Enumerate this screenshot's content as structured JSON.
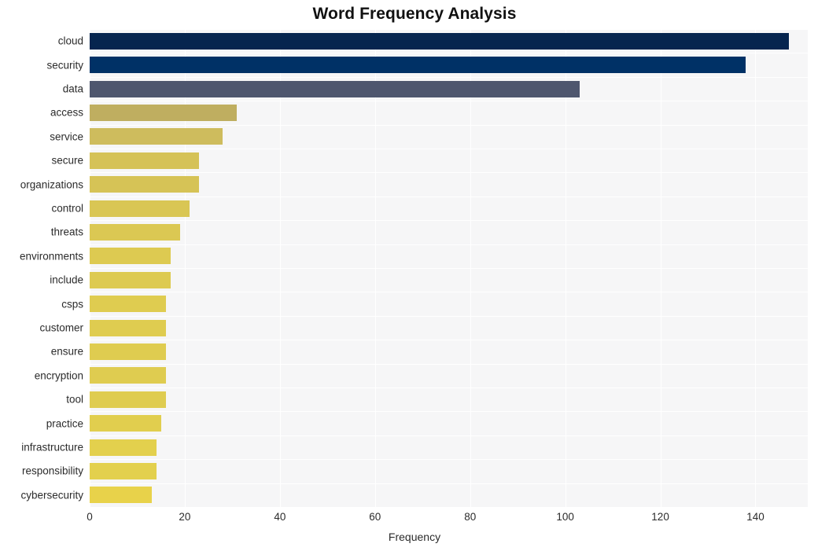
{
  "chart_data": {
    "type": "bar",
    "orientation": "horizontal",
    "title": "Word Frequency Analysis",
    "xlabel": "Frequency",
    "ylabel": "",
    "xlim": [
      0,
      151
    ],
    "xticks": [
      0,
      20,
      40,
      60,
      80,
      100,
      120,
      140
    ],
    "xtick_labels": [
      "0",
      "20",
      "40",
      "60",
      "80",
      "100",
      "120",
      "140"
    ],
    "grid": true,
    "legend": "none",
    "categories": [
      "cloud",
      "security",
      "data",
      "access",
      "service",
      "secure",
      "organizations",
      "control",
      "threats",
      "environments",
      "include",
      "csps",
      "customer",
      "ensure",
      "encryption",
      "tool",
      "practice",
      "infrastructure",
      "responsibility",
      "cybersecurity"
    ],
    "values": [
      147,
      138,
      103,
      31,
      28,
      23,
      23,
      21,
      19,
      17,
      17,
      16,
      16,
      16,
      16,
      16,
      15,
      14,
      14,
      13
    ],
    "bar_colors": [
      "#06254f",
      "#003166",
      "#4e566e",
      "#bfae60",
      "#cebc5d",
      "#d5c257",
      "#d6c356",
      "#d9c654",
      "#dbc853",
      "#ddca51",
      "#ddca51",
      "#dfcc50",
      "#dfcc50",
      "#dfcc50",
      "#dfcc50",
      "#dfcc50",
      "#e1ce4e",
      "#e3d04d",
      "#e3d04d",
      "#e8d24a"
    ],
    "plot_background": "#f6f6f7",
    "grid_color": "#ffffff",
    "figure_background": "#ffffff",
    "text_color": "#2b2b2b"
  }
}
